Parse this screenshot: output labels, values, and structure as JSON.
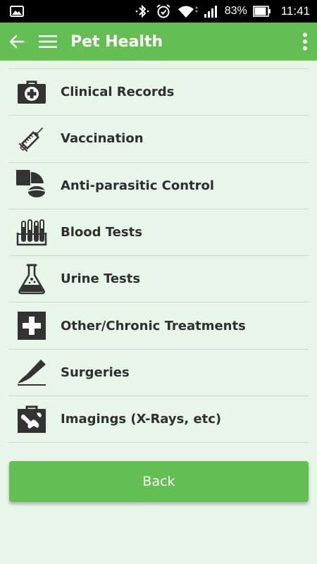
{
  "status_bar": {
    "battery_percent": "83%",
    "time": "11:41",
    "icons": [
      "image-icon",
      "bluetooth-icon",
      "alarm-icon",
      "wifi-icon",
      "signal-icon",
      "battery-icon"
    ]
  },
  "app_bar": {
    "title": "Pet Health",
    "icons": [
      "back-arrow-icon",
      "hamburger-menu-icon",
      "overflow-menu-icon"
    ],
    "color": "#64bf52"
  },
  "list": {
    "items": [
      {
        "label": "Clinical Records",
        "icon": "medical-kit-icon"
      },
      {
        "label": "Vaccination",
        "icon": "syringe-icon"
      },
      {
        "label": "Anti-parasitic Control",
        "icon": "pills-icon"
      },
      {
        "label": "Blood Tests",
        "icon": "test-tubes-icon"
      },
      {
        "label": "Urine Tests",
        "icon": "flask-icon"
      },
      {
        "label": "Other/Chronic Treatments",
        "icon": "medical-cross-icon"
      },
      {
        "label": "Surgeries",
        "icon": "scalpel-icon"
      },
      {
        "label": "Imagings (X-Rays, etc)",
        "icon": "xray-icon"
      }
    ]
  },
  "back_button": {
    "label": "Back"
  },
  "colors": {
    "background": "#e8f5e9",
    "accent": "#64bf52",
    "text": "#2f2f2f"
  }
}
